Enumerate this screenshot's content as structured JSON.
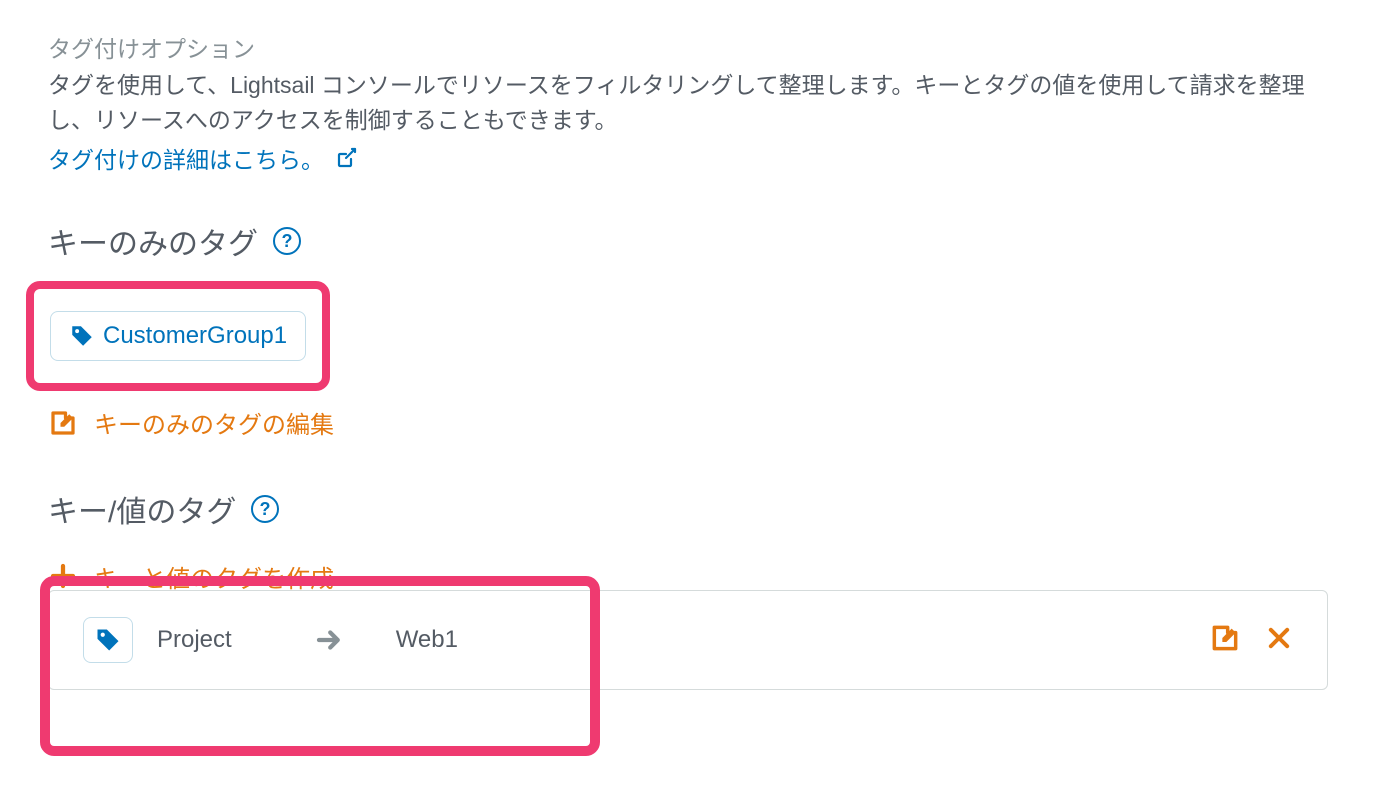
{
  "header": {
    "options_label": "タグ付けオプション",
    "description": "タグを使用して、Lightsail コンソールでリソースをフィルタリングして整理します。キーとタグの値を使用して請求を整理し、リソースへのアクセスを制御することもできます。",
    "learn_more": "タグ付けの詳細はこちら。"
  },
  "key_only": {
    "heading": "キーのみのタグ",
    "tags": [
      "CustomerGroup1"
    ],
    "edit_label": "キーのみのタグの編集"
  },
  "key_value": {
    "heading": "キー/値のタグ",
    "create_label": "キーと値のタグを作成",
    "rows": [
      {
        "key": "Project",
        "value": "Web1"
      }
    ]
  },
  "colors": {
    "link": "#0073bb",
    "accent": "#e47911",
    "highlight": "#ef3a70",
    "muted": "#545b64"
  }
}
